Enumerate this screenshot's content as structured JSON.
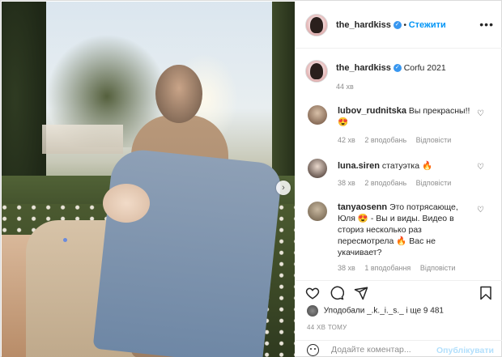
{
  "post": {
    "author": "the_hardkiss",
    "follow_label": "Стежити",
    "more_icon": "•••",
    "verified_icon": "✓",
    "caption": {
      "username": "the_hardkiss",
      "text": "Corfu 2021",
      "time": "44 хв"
    },
    "comments": [
      {
        "username": "lubov_rudnitska",
        "text": "Вы прекрасны!! 😍",
        "time": "42 хв",
        "likes": "2 вподобань",
        "reply": "Відповісти"
      },
      {
        "username": "luna.siren",
        "text": "статуэтка 🔥",
        "time": "38 хв",
        "likes": "2 вподобань",
        "reply": "Відповісти"
      },
      {
        "username": "tanyaosenn",
        "text": "Это потрясающе, Юля 😍 - Вы и виды. Видео в сториз несколько раз пересмотрела 🔥 Вас не укачивает?",
        "time": "38 хв",
        "likes": "1 вподобання",
        "reply": "Відповісти"
      }
    ],
    "likes_text": "Уподобали _.k._i._s._ і ще 9 481",
    "timestamp": "44 ХВ ТОМУ",
    "comment_placeholder": "Додайте коментар...",
    "publish_label": "Опублікувати",
    "icons": {
      "like": "heart-icon",
      "comment": "comment-icon",
      "share": "share-icon",
      "save": "bookmark-icon",
      "next": "chevron-right-icon",
      "emoji": "emoji-icon"
    },
    "colors": {
      "link": "#0095f6",
      "verified": "#3897f0",
      "muted": "#8e8e8e",
      "publish_disabled": "#b2dffc"
    }
  }
}
